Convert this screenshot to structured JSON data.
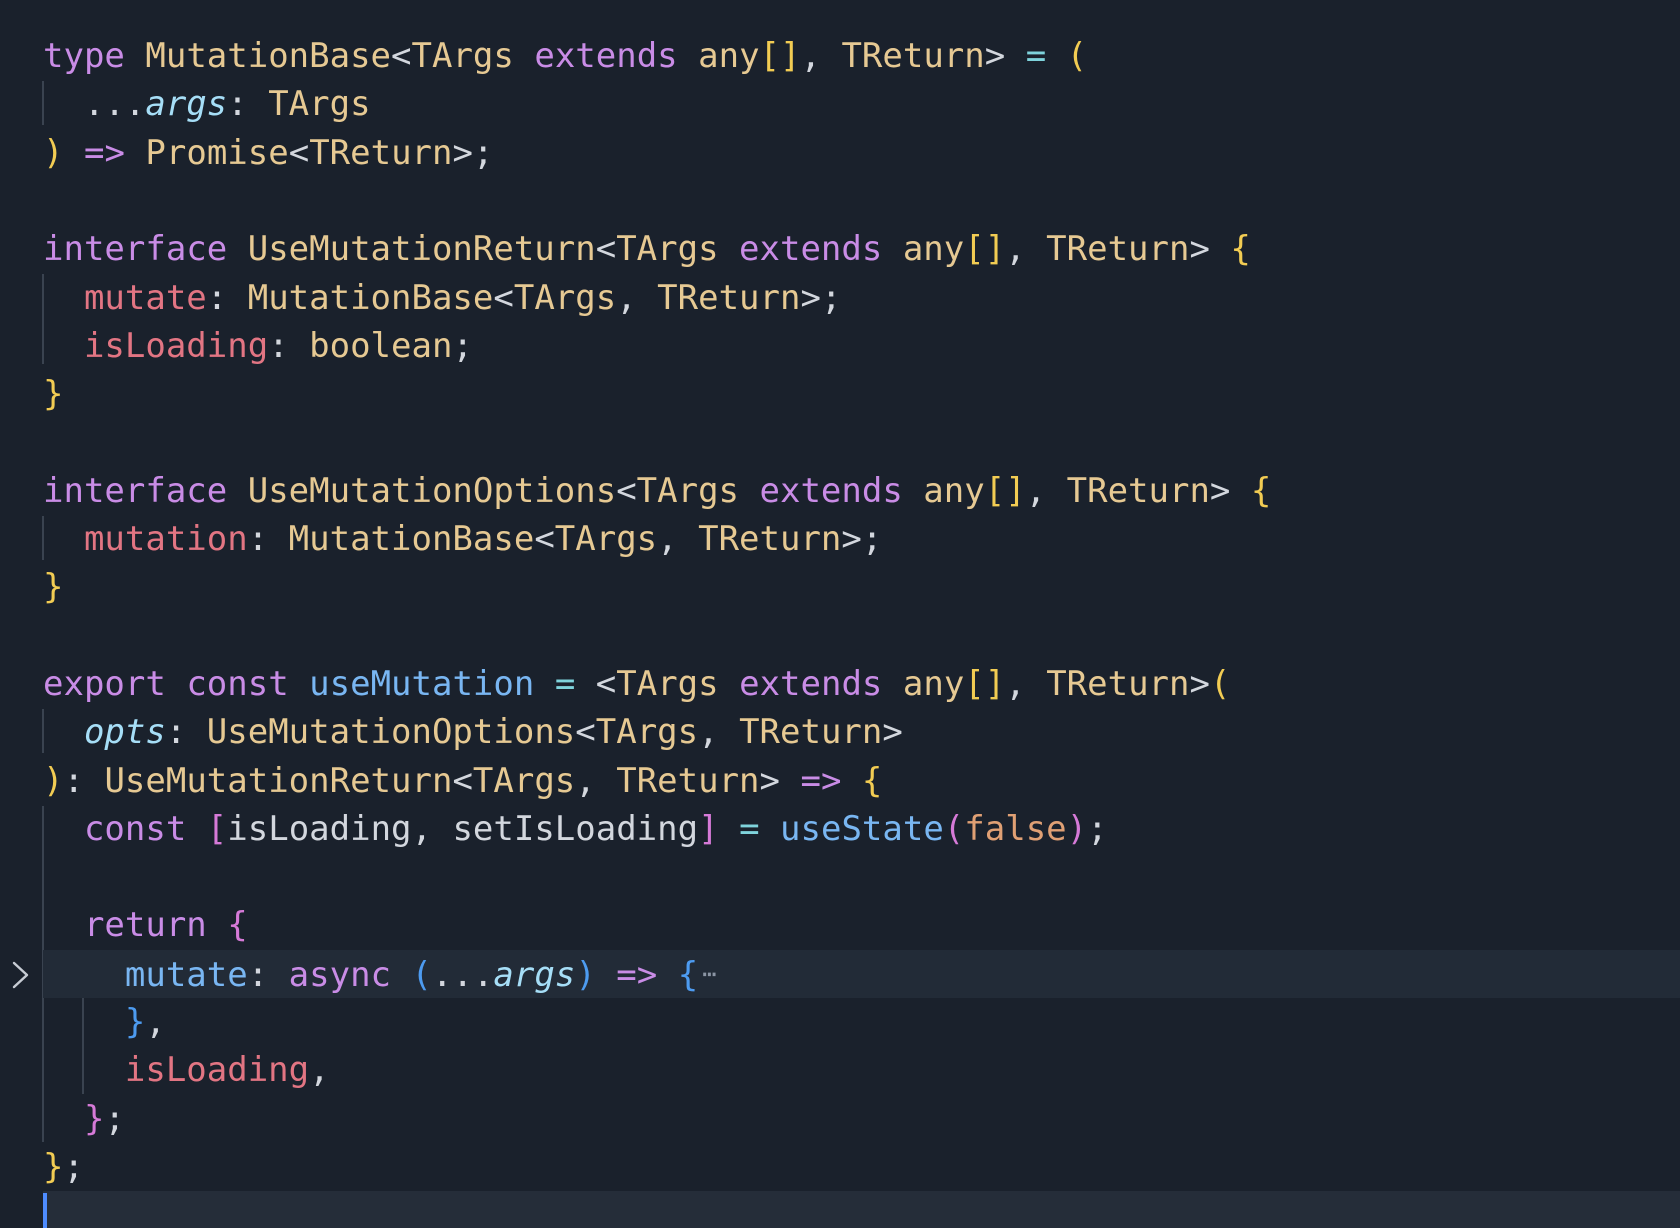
{
  "editor": {
    "cursor_line": 25,
    "folded_line": 20,
    "colors": {
      "background": "#1a212c",
      "current_line": "#222b37",
      "keyword": "#c98ce6",
      "type": "#e6c993",
      "property": "#e27583",
      "function": "#79b6f2",
      "parameter": "#a6def7",
      "operator": "#7fd3dc",
      "punctuation": "#d3d7de",
      "bracket_level1": "#f2cc53",
      "bracket_level2": "#d67ad8",
      "bracket_level3": "#4d9bf0",
      "literal": "#e0a074",
      "cursor": "#4e8cff"
    },
    "lines": [
      {
        "line": 1,
        "tokens": [
          {
            "t": "type",
            "c": "keyword"
          },
          {
            "t": " ",
            "c": "punctuation"
          },
          {
            "t": "MutationBase",
            "c": "type"
          },
          {
            "t": "<",
            "c": "punctuation"
          },
          {
            "t": "TArgs",
            "c": "type"
          },
          {
            "t": " ",
            "c": "punctuation"
          },
          {
            "t": "extends",
            "c": "keyword"
          },
          {
            "t": " ",
            "c": "punctuation"
          },
          {
            "t": "any",
            "c": "type"
          },
          {
            "t": "[]",
            "c": "bracket_level1"
          },
          {
            "t": ", ",
            "c": "punctuation"
          },
          {
            "t": "TReturn",
            "c": "type"
          },
          {
            "t": "> ",
            "c": "punctuation"
          },
          {
            "t": "=",
            "c": "operator"
          },
          {
            "t": " ",
            "c": "punctuation"
          },
          {
            "t": "(",
            "c": "bracket_level1"
          }
        ]
      },
      {
        "line": 2,
        "tokens": [
          {
            "t": "  ...",
            "c": "punctuation"
          },
          {
            "t": "args",
            "c": "parameter",
            "italic": true
          },
          {
            "t": ": ",
            "c": "punctuation"
          },
          {
            "t": "TArgs",
            "c": "type"
          }
        ]
      },
      {
        "line": 3,
        "tokens": [
          {
            "t": ")",
            "c": "bracket_level1"
          },
          {
            "t": " ",
            "c": "punctuation"
          },
          {
            "t": "=>",
            "c": "keyword"
          },
          {
            "t": " ",
            "c": "punctuation"
          },
          {
            "t": "Promise",
            "c": "type"
          },
          {
            "t": "<",
            "c": "punctuation"
          },
          {
            "t": "TReturn",
            "c": "type"
          },
          {
            "t": ">;",
            "c": "punctuation"
          }
        ]
      },
      {
        "line": 4,
        "tokens": []
      },
      {
        "line": 5,
        "tokens": [
          {
            "t": "interface",
            "c": "keyword"
          },
          {
            "t": " ",
            "c": "punctuation"
          },
          {
            "t": "UseMutationReturn",
            "c": "type"
          },
          {
            "t": "<",
            "c": "punctuation"
          },
          {
            "t": "TArgs",
            "c": "type"
          },
          {
            "t": " ",
            "c": "punctuation"
          },
          {
            "t": "extends",
            "c": "keyword"
          },
          {
            "t": " ",
            "c": "punctuation"
          },
          {
            "t": "any",
            "c": "type"
          },
          {
            "t": "[]",
            "c": "bracket_level1"
          },
          {
            "t": ", ",
            "c": "punctuation"
          },
          {
            "t": "TReturn",
            "c": "type"
          },
          {
            "t": "> ",
            "c": "punctuation"
          },
          {
            "t": "{",
            "c": "bracket_level1"
          }
        ]
      },
      {
        "line": 6,
        "tokens": [
          {
            "t": "  ",
            "c": "punctuation"
          },
          {
            "t": "mutate",
            "c": "property"
          },
          {
            "t": ": ",
            "c": "punctuation"
          },
          {
            "t": "MutationBase",
            "c": "type"
          },
          {
            "t": "<",
            "c": "punctuation"
          },
          {
            "t": "TArgs",
            "c": "type"
          },
          {
            "t": ", ",
            "c": "punctuation"
          },
          {
            "t": "TReturn",
            "c": "type"
          },
          {
            "t": ">;",
            "c": "punctuation"
          }
        ]
      },
      {
        "line": 7,
        "tokens": [
          {
            "t": "  ",
            "c": "punctuation"
          },
          {
            "t": "isLoading",
            "c": "property"
          },
          {
            "t": ": ",
            "c": "punctuation"
          },
          {
            "t": "boolean",
            "c": "type"
          },
          {
            "t": ";",
            "c": "punctuation"
          }
        ]
      },
      {
        "line": 8,
        "tokens": [
          {
            "t": "}",
            "c": "bracket_level1"
          }
        ]
      },
      {
        "line": 9,
        "tokens": []
      },
      {
        "line": 10,
        "tokens": [
          {
            "t": "interface",
            "c": "keyword"
          },
          {
            "t": " ",
            "c": "punctuation"
          },
          {
            "t": "UseMutationOptions",
            "c": "type"
          },
          {
            "t": "<",
            "c": "punctuation"
          },
          {
            "t": "TArgs",
            "c": "type"
          },
          {
            "t": " ",
            "c": "punctuation"
          },
          {
            "t": "extends",
            "c": "keyword"
          },
          {
            "t": " ",
            "c": "punctuation"
          },
          {
            "t": "any",
            "c": "type"
          },
          {
            "t": "[]",
            "c": "bracket_level1"
          },
          {
            "t": ", ",
            "c": "punctuation"
          },
          {
            "t": "TReturn",
            "c": "type"
          },
          {
            "t": "> ",
            "c": "punctuation"
          },
          {
            "t": "{",
            "c": "bracket_level1"
          }
        ]
      },
      {
        "line": 11,
        "tokens": [
          {
            "t": "  ",
            "c": "punctuation"
          },
          {
            "t": "mutation",
            "c": "property"
          },
          {
            "t": ": ",
            "c": "punctuation"
          },
          {
            "t": "MutationBase",
            "c": "type"
          },
          {
            "t": "<",
            "c": "punctuation"
          },
          {
            "t": "TArgs",
            "c": "type"
          },
          {
            "t": ", ",
            "c": "punctuation"
          },
          {
            "t": "TReturn",
            "c": "type"
          },
          {
            "t": ">;",
            "c": "punctuation"
          }
        ]
      },
      {
        "line": 12,
        "tokens": [
          {
            "t": "}",
            "c": "bracket_level1"
          }
        ]
      },
      {
        "line": 13,
        "tokens": []
      },
      {
        "line": 14,
        "tokens": [
          {
            "t": "export",
            "c": "keyword"
          },
          {
            "t": " ",
            "c": "punctuation"
          },
          {
            "t": "const",
            "c": "keyword"
          },
          {
            "t": " ",
            "c": "punctuation"
          },
          {
            "t": "useMutation",
            "c": "function"
          },
          {
            "t": " ",
            "c": "punctuation"
          },
          {
            "t": "=",
            "c": "operator"
          },
          {
            "t": " <",
            "c": "punctuation"
          },
          {
            "t": "TArgs",
            "c": "type"
          },
          {
            "t": " ",
            "c": "punctuation"
          },
          {
            "t": "extends",
            "c": "keyword"
          },
          {
            "t": " ",
            "c": "punctuation"
          },
          {
            "t": "any",
            "c": "type"
          },
          {
            "t": "[]",
            "c": "bracket_level1"
          },
          {
            "t": ", ",
            "c": "punctuation"
          },
          {
            "t": "TReturn",
            "c": "type"
          },
          {
            "t": ">",
            "c": "punctuation"
          },
          {
            "t": "(",
            "c": "bracket_level1"
          }
        ]
      },
      {
        "line": 15,
        "tokens": [
          {
            "t": "  ",
            "c": "punctuation"
          },
          {
            "t": "opts",
            "c": "parameter",
            "italic": true
          },
          {
            "t": ": ",
            "c": "punctuation"
          },
          {
            "t": "UseMutationOptions",
            "c": "type"
          },
          {
            "t": "<",
            "c": "punctuation"
          },
          {
            "t": "TArgs",
            "c": "type"
          },
          {
            "t": ", ",
            "c": "punctuation"
          },
          {
            "t": "TReturn",
            "c": "type"
          },
          {
            "t": ">",
            "c": "punctuation"
          }
        ]
      },
      {
        "line": 16,
        "tokens": [
          {
            "t": ")",
            "c": "bracket_level1"
          },
          {
            "t": ": ",
            "c": "punctuation"
          },
          {
            "t": "UseMutationReturn",
            "c": "type"
          },
          {
            "t": "<",
            "c": "punctuation"
          },
          {
            "t": "TArgs",
            "c": "type"
          },
          {
            "t": ", ",
            "c": "punctuation"
          },
          {
            "t": "TReturn",
            "c": "type"
          },
          {
            "t": "> ",
            "c": "punctuation"
          },
          {
            "t": "=>",
            "c": "keyword"
          },
          {
            "t": " ",
            "c": "punctuation"
          },
          {
            "t": "{",
            "c": "bracket_level1"
          }
        ]
      },
      {
        "line": 17,
        "tokens": [
          {
            "t": "  ",
            "c": "punctuation"
          },
          {
            "t": "const",
            "c": "keyword"
          },
          {
            "t": " ",
            "c": "punctuation"
          },
          {
            "t": "[",
            "c": "bracket_level2"
          },
          {
            "t": "isLoading, setIsLoading",
            "c": "punctuation"
          },
          {
            "t": "]",
            "c": "bracket_level2"
          },
          {
            "t": " ",
            "c": "punctuation"
          },
          {
            "t": "=",
            "c": "operator"
          },
          {
            "t": " ",
            "c": "punctuation"
          },
          {
            "t": "useState",
            "c": "function"
          },
          {
            "t": "(",
            "c": "bracket_level2"
          },
          {
            "t": "false",
            "c": "literal"
          },
          {
            "t": ")",
            "c": "bracket_level2"
          },
          {
            "t": ";",
            "c": "punctuation"
          }
        ]
      },
      {
        "line": 18,
        "tokens": []
      },
      {
        "line": 19,
        "tokens": [
          {
            "t": "  ",
            "c": "punctuation"
          },
          {
            "t": "return",
            "c": "keyword"
          },
          {
            "t": " ",
            "c": "punctuation"
          },
          {
            "t": "{",
            "c": "bracket_level2"
          }
        ]
      },
      {
        "line": 20,
        "tokens": [
          {
            "t": "    ",
            "c": "punctuation"
          },
          {
            "t": "mutate",
            "c": "function"
          },
          {
            "t": ": ",
            "c": "punctuation"
          },
          {
            "t": "async",
            "c": "keyword"
          },
          {
            "t": " ",
            "c": "punctuation"
          },
          {
            "t": "(",
            "c": "bracket_level3"
          },
          {
            "t": "...",
            "c": "punctuation"
          },
          {
            "t": "args",
            "c": "parameter",
            "italic": true
          },
          {
            "t": ")",
            "c": "bracket_level3"
          },
          {
            "t": " ",
            "c": "punctuation"
          },
          {
            "t": "=>",
            "c": "keyword"
          },
          {
            "t": " ",
            "c": "punctuation"
          },
          {
            "t": "{",
            "c": "bracket_level3"
          }
        ]
      },
      {
        "line": 21,
        "tokens": [
          {
            "t": "    ",
            "c": "punctuation"
          },
          {
            "t": "}",
            "c": "bracket_level3"
          },
          {
            "t": ",",
            "c": "punctuation"
          }
        ]
      },
      {
        "line": 22,
        "tokens": [
          {
            "t": "    ",
            "c": "punctuation"
          },
          {
            "t": "isLoading",
            "c": "property"
          },
          {
            "t": ",",
            "c": "punctuation"
          }
        ]
      },
      {
        "line": 23,
        "tokens": [
          {
            "t": "  ",
            "c": "punctuation"
          },
          {
            "t": "}",
            "c": "bracket_level2"
          },
          {
            "t": ";",
            "c": "punctuation"
          }
        ]
      },
      {
        "line": 24,
        "tokens": [
          {
            "t": "}",
            "c": "bracket_level1"
          },
          {
            "t": ";",
            "c": "punctuation"
          }
        ]
      },
      {
        "line": 25,
        "tokens": []
      }
    ]
  }
}
